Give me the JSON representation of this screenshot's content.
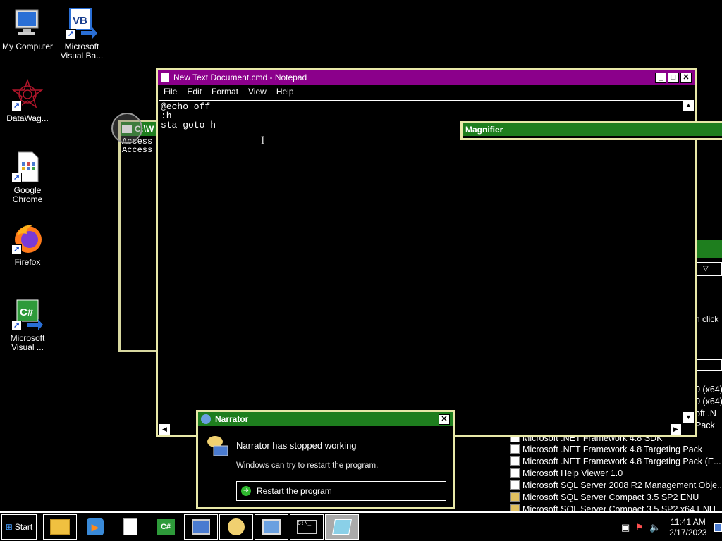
{
  "desktop_icons": [
    {
      "label": "My Computer",
      "icon": "my-computer-icon"
    },
    {
      "label": "Microsoft Visual Ba...",
      "icon": "visual-basic-icon"
    },
    {
      "label": "DataWag...",
      "icon": "datawag-icon"
    },
    {
      "label": "Google Chrome",
      "icon": "chrome-icon"
    },
    {
      "label": "Firefox",
      "icon": "firefox-icon"
    },
    {
      "label": "Microsoft Visual ...",
      "icon": "visual-csharp-icon"
    }
  ],
  "cmd_window": {
    "title": "C:\\W",
    "lines": [
      "Access",
      "Access"
    ]
  },
  "notepad": {
    "title": "New Text Document.cmd - Notepad",
    "menu": [
      "File",
      "Edit",
      "Format",
      "View",
      "Help"
    ],
    "content": "@echo off\n:h\nsta goto h",
    "title_color": "#8b008b"
  },
  "magnifier": {
    "title": "Magnifier",
    "title_color": "#1e7e1e"
  },
  "narrator_dialog": {
    "title": "Narrator",
    "heading": "Narrator has stopped working",
    "message": "Windows can try to restart the program.",
    "restart_label": "Restart the program",
    "title_color": "#1e7e1e"
  },
  "background_window": {
    "fragments": [
      "n click",
      "0 (x64)",
      "0 (x64)",
      "oft .N",
      "Pack"
    ]
  },
  "programs_list": [
    "Microsoft .NET Framework 4.8 SDK",
    "Microsoft .NET Framework 4.8 Targeting Pack",
    "Microsoft .NET Framework 4.8 Targeting Pack (E...",
    "Microsoft Help Viewer 1.0",
    "Microsoft SQL Server 2008 R2 Management Obje...",
    "Microsoft SQL Server Compact 3.5 SP2 ENU",
    "Microsoft SQL Server Compact 3.5 SP2 x64 ENU"
  ],
  "taskbar": {
    "start_label": "Start",
    "clock_time": "11:41 AM",
    "clock_date": "2/17/2023"
  }
}
